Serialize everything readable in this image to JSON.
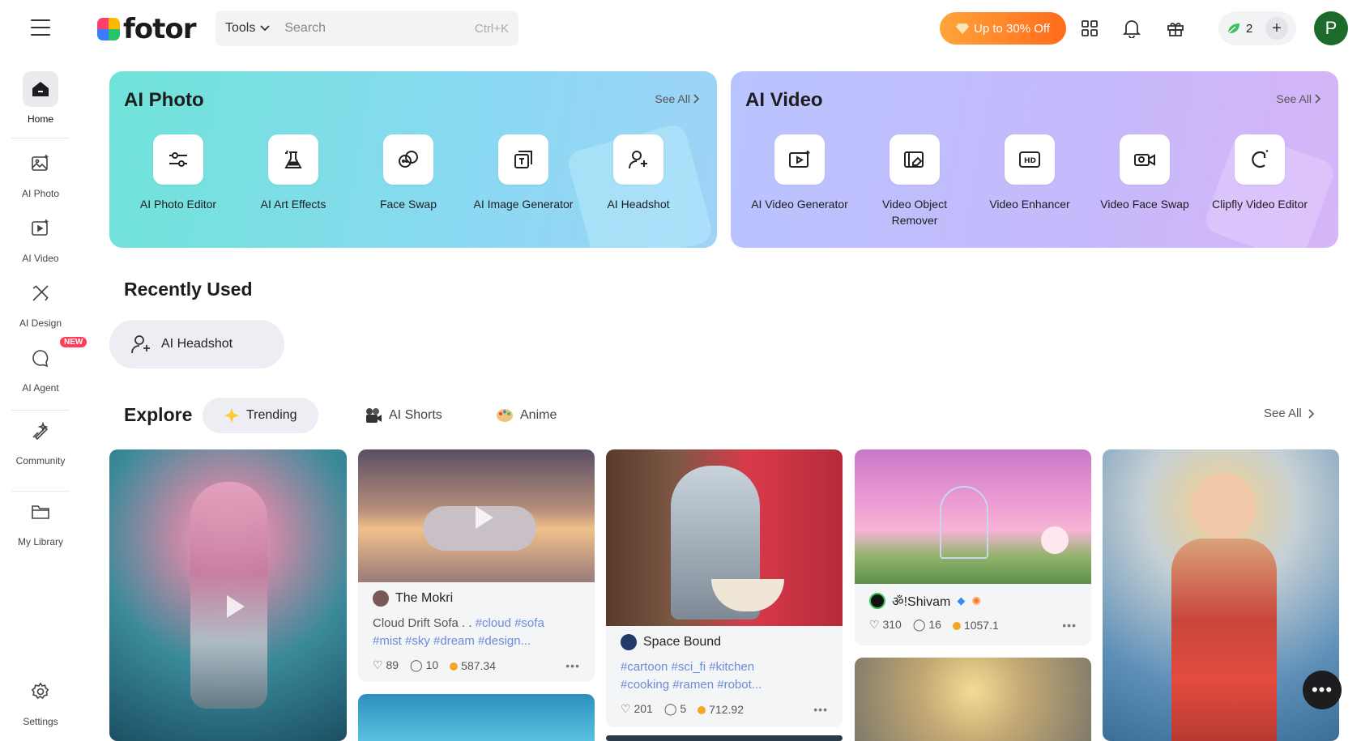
{
  "header": {
    "logo_text": "fotor",
    "tools_label": "Tools",
    "search_placeholder": "Search",
    "search_shortcut": "Ctrl+K",
    "promo_label": "Up to 30% Off",
    "credits_count": "2",
    "avatar_initial": "P"
  },
  "sidebar": {
    "items": [
      {
        "label": "Home"
      },
      {
        "label": "AI Photo"
      },
      {
        "label": "AI Video"
      },
      {
        "label": "AI Design"
      },
      {
        "label": "AI Agent",
        "badge": "NEW"
      },
      {
        "label": "Community"
      },
      {
        "label": "My Library"
      },
      {
        "label": "Settings"
      }
    ]
  },
  "ai_photo": {
    "title": "AI Photo",
    "see_all": "See All",
    "tools": [
      "AI Photo Editor",
      "AI Art Effects",
      "Face Swap",
      "AI Image Generator",
      "AI Headshot"
    ]
  },
  "ai_video": {
    "title": "AI Video",
    "see_all": "See All",
    "tools": [
      "AI Video Generator",
      "Video Object Remover",
      "Video Enhancer",
      "Video Face Swap",
      "Clipfly Video Editor"
    ]
  },
  "recent": {
    "title": "Recently Used",
    "chip": "AI Headshot"
  },
  "explore": {
    "title": "Explore",
    "tabs": [
      "Trending",
      "AI Shorts",
      "Anime"
    ],
    "see_all": "See All"
  },
  "posts": [
    {
      "author": "The Mokri",
      "desc": "Cloud Drift Sofa . . ",
      "tags1": "#cloud #sofa",
      "tags2": "#mist #sky #dream #design...",
      "likes": "89",
      "comments": "10",
      "credits": "587.34"
    },
    {
      "author": "Space Bound",
      "desc": "",
      "tags1": "#cartoon #sci_fi #kitchen",
      "tags2": "#cooking #ramen #robot...",
      "likes": "201",
      "comments": "5",
      "credits": "712.92"
    },
    {
      "author": "ॐ!Shivam",
      "likes": "310",
      "comments": "16",
      "credits": "1057.1"
    }
  ],
  "colors": {
    "promo": "#ff7a1f",
    "avatar": "#1c6b2a",
    "tag": "#6c8bd8"
  }
}
